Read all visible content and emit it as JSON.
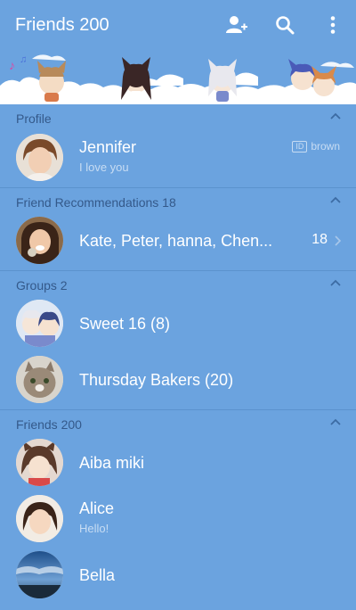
{
  "header": {
    "title": "Friends 200",
    "icons": [
      "add-friend-icon",
      "search-icon",
      "more-vert-icon"
    ]
  },
  "sections": {
    "profile": {
      "label": "Profile"
    },
    "recommendations": {
      "label": "Friend Recommendations 18"
    },
    "groups": {
      "label": "Groups 2"
    },
    "friends": {
      "label": "Friends 200"
    }
  },
  "profile": {
    "name": "Jennifer",
    "status": "I love you",
    "id_badge": "ID",
    "id_value": "brown"
  },
  "recommendations": {
    "names": "Kate, Peter, hanna, Chen...",
    "count": "18"
  },
  "groups": [
    {
      "name": "Sweet 16 (8)"
    },
    {
      "name": "Thursday Bakers (20)"
    }
  ],
  "friends": [
    {
      "name": "Aiba miki",
      "status": ""
    },
    {
      "name": "Alice",
      "status": "Hello!"
    },
    {
      "name": "Bella",
      "status": ""
    }
  ],
  "colors": {
    "background": "#6ba3df",
    "section_label": "#34598a",
    "divider": "#5b92cd",
    "subtext": "#c7dcf3"
  }
}
